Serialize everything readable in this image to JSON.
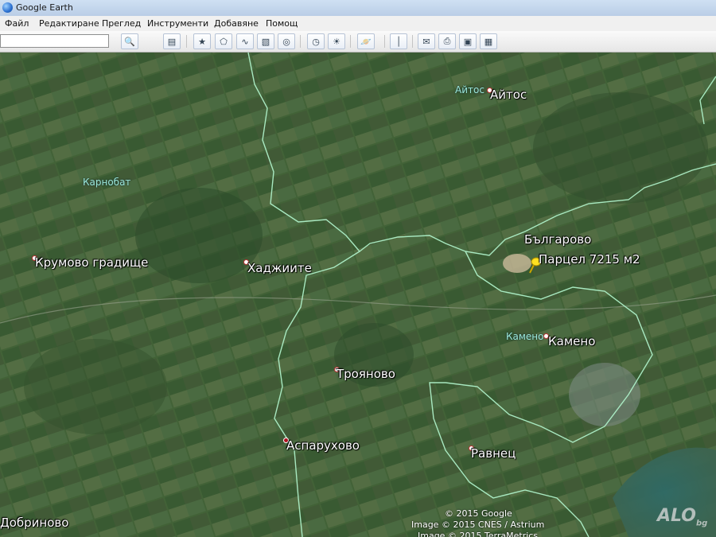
{
  "window": {
    "title": "Google Earth"
  },
  "menu": [
    "Файл",
    "Редактиране",
    "Преглед",
    "Инструменти",
    "Добавяне",
    "Помощ"
  ],
  "search": {
    "value": "",
    "placeholder": ""
  },
  "toolbar_icons": [
    "sidebar-icon",
    "placemark-icon",
    "polygon-icon",
    "path-icon",
    "image-overlay-icon",
    "record-tour-icon",
    "historical-imagery-icon",
    "sun-icon",
    "planets-icon",
    "ruler-icon",
    "email-icon",
    "print-icon",
    "save-image-icon",
    "view-in-maps-icon"
  ],
  "map": {
    "places": [
      {
        "name": "Айтос",
        "kind": "town"
      },
      {
        "name": "Карнобат",
        "kind": "region-label"
      },
      {
        "name": "Крумово градище",
        "kind": "village"
      },
      {
        "name": "Хаджиите",
        "kind": "village"
      },
      {
        "name": "Българово",
        "kind": "village"
      },
      {
        "name": "Парцел 7215 м2",
        "kind": "placemark"
      },
      {
        "name": "Камено",
        "kind": "region-label"
      },
      {
        "name": "Камено",
        "kind": "village"
      },
      {
        "name": "Трояново",
        "kind": "village"
      },
      {
        "name": "Аспарухово",
        "kind": "village"
      },
      {
        "name": "Равнец",
        "kind": "village"
      },
      {
        "name": "Добриново",
        "kind": "village"
      },
      {
        "name": "Айтос",
        "kind": "region-label"
      }
    ],
    "copyright": [
      "© 2015 Google",
      "Image © 2015 CNES / Astrium",
      "Image © 2015 TerraMetrics"
    ],
    "watermark": "ALO",
    "watermark_suffix": "bg"
  },
  "colors": {
    "border": "#aef0c8",
    "terrain": "#3d5a34"
  }
}
